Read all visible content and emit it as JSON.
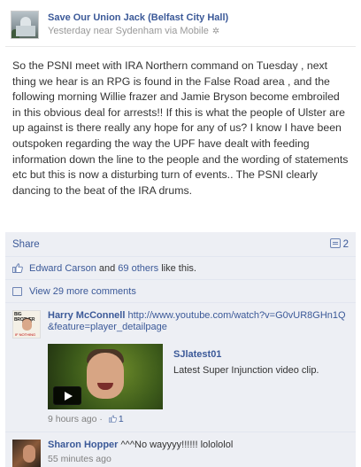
{
  "post": {
    "page_name": "Save Our Union Jack (Belfast City Hall)",
    "meta": "Yesterday near Sydenham via Mobile",
    "body": "So the PSNI meet with IRA Northern command on Tuesday , next thing we hear is an RPG is found in the False Road area , and the following morning Willie frazer and Jamie Bryson become embroiled in this obvious deal for arrests!! If this is what the people of Ulster are up against is there really any hope for any of us? I know I have been outspoken regarding the way the UPF have dealt with feeding information down the line to the people and the wording of statements etc but this is now a disturbing turn of events.. The PSNI clearly dancing to the beat of the IRA drums."
  },
  "actions": {
    "share_label": "Share",
    "share_count": "2"
  },
  "likes": {
    "name": "Edward Carson",
    "and": " and ",
    "others": "69 others",
    "suffix": " like this."
  },
  "more_comments": "View 29 more comments",
  "comments": [
    {
      "author": "Harry McConnell",
      "text": "",
      "url": "http://www.youtube.com/watch?v=G0vUR8GHn1Q&feature=player_detailpage",
      "avatar_text_top": "BIG BROTHER",
      "avatar_text_bottom": "IF NOTHING",
      "attachment_title": "SJlatest01",
      "attachment_desc": "Latest Super Injunction video clip.",
      "time": "9 hours ago",
      "sep": " · ",
      "likes": "1"
    },
    {
      "author": "Sharon Hopper",
      "text": " ^^^No wayyyy!!!!!! lolololol",
      "time": "55 minutes ago"
    }
  ],
  "colors": {
    "link": "#3b5998",
    "ufi_background": "#edeff4",
    "meta": "#999999"
  },
  "icons": [
    "gear-icon",
    "share-count-icon",
    "like-thumb-icon",
    "comments-icon",
    "play-icon"
  ]
}
